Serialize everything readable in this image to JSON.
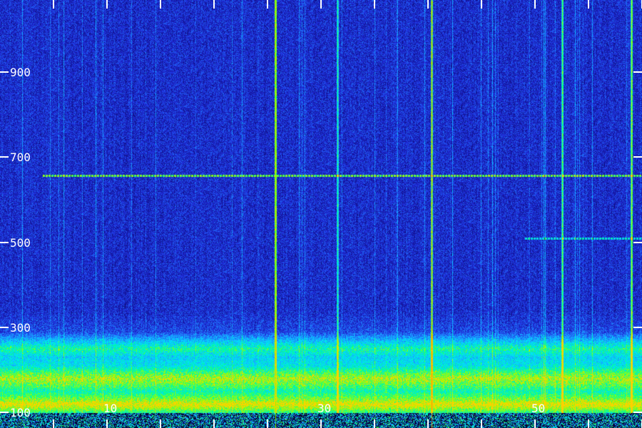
{
  "chart_data": {
    "type": "heatmap",
    "title": "",
    "xlabel": "",
    "ylabel": "",
    "y_ticks": [
      {
        "value": 900,
        "label": "900"
      },
      {
        "value": 700,
        "label": "700"
      },
      {
        "value": 500,
        "label": "500"
      },
      {
        "value": 300,
        "label": "300"
      },
      {
        "value": 100,
        "label": "100"
      }
    ],
    "x_ticks": [
      {
        "value": 10,
        "label": "10"
      },
      {
        "value": 30,
        "label": "30"
      },
      {
        "value": 50,
        "label": "50"
      }
    ],
    "ylim": [
      100,
      1070
    ],
    "xlim": [
      0,
      60
    ],
    "colormap": [
      "#000010",
      "#10108a",
      "#2030e0",
      "#1e90ff",
      "#00e0ff",
      "#00ff90",
      "#a0ff00",
      "#ffd000"
    ],
    "features": {
      "horizontal_lines": [
        {
          "y": 658,
          "x_range": [
            4,
            60
          ],
          "strength": 0.55
        },
        {
          "y": 510,
          "x_range": [
            49,
            60
          ],
          "strength": 0.35
        }
      ],
      "vertical_lines": [
        {
          "x": 25.7,
          "strength": 0.95,
          "color": "#80ff00"
        },
        {
          "x": 40.3,
          "strength": 0.8,
          "color": "#e0a000"
        },
        {
          "x": 31.5,
          "strength": 0.45
        },
        {
          "x": 52.5,
          "strength": 0.55
        },
        {
          "x": 59.0,
          "strength": 0.6
        }
      ],
      "low_freq_bands": [
        {
          "y_center": 180,
          "width": 50,
          "strength": 0.55
        },
        {
          "y_center": 250,
          "width": 40,
          "strength": 0.4
        },
        {
          "y_center": 120,
          "width": 30,
          "strength": 0.6
        }
      ]
    },
    "grid": false
  }
}
